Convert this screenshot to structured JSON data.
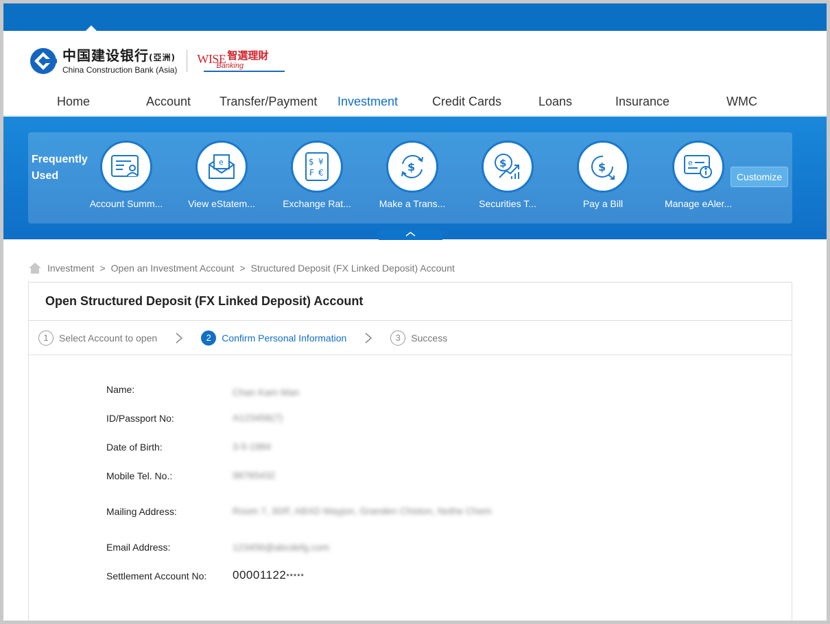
{
  "brand": {
    "cn_name": "中国建设银行",
    "cn_suffix": "(亞洲)",
    "en_name": "China Construction Bank (Asia)",
    "wise_word": "WISE",
    "wise_cn": "智選理財",
    "wise_banking": "Banking",
    "accent": "#0b6fc3"
  },
  "nav": {
    "items": [
      {
        "label": "Home"
      },
      {
        "label": "Account"
      },
      {
        "label": "Transfer/Payment"
      },
      {
        "label": "Investment",
        "active": true
      },
      {
        "label": "Credit Cards"
      },
      {
        "label": "Loans"
      },
      {
        "label": "Insurance"
      },
      {
        "label": "WMC"
      }
    ]
  },
  "frequently_used": {
    "title": "Frequently Used",
    "items": [
      {
        "label": "Account Summ...",
        "icon": "account-summary-icon"
      },
      {
        "label": "View eStatem...",
        "icon": "estatement-icon"
      },
      {
        "label": "Exchange Rat...",
        "icon": "exchange-rate-icon"
      },
      {
        "label": "Make a Trans...",
        "icon": "transfer-icon"
      },
      {
        "label": "Securities T...",
        "icon": "securities-icon"
      },
      {
        "label": "Pay a Bill",
        "icon": "pay-bill-icon"
      },
      {
        "label": "Manage eAler...",
        "icon": "ealert-icon"
      }
    ],
    "customize_label": "Customize"
  },
  "breadcrumb": {
    "items": [
      "Investment",
      "Open an Investment Account",
      "Structured Deposit (FX Linked Deposit) Account"
    ],
    "separator": ">"
  },
  "page": {
    "title": "Open Structured Deposit (FX Linked Deposit) Account"
  },
  "steps": [
    {
      "num": "1",
      "label": "Select Account to open"
    },
    {
      "num": "2",
      "label": "Confirm Personal Information",
      "active": true
    },
    {
      "num": "3",
      "label": "Success"
    }
  ],
  "personal_info": [
    {
      "label": "Name:",
      "value": "Chan Kam Man"
    },
    {
      "label": "ID/Passport No:",
      "value": "A123456(7)"
    },
    {
      "label": "Date of Birth:",
      "value": "3-5-1984"
    },
    {
      "label": "Mobile Tel. No.:",
      "value": "98765432"
    },
    {
      "label": "Mailing Address:",
      "value": "Room 7, 30/F, ABXD Mayjon, Granden Chiston, Nothe Chem"
    },
    {
      "label": "Email Address:",
      "value": "123456@abcdefg.com"
    },
    {
      "label": "Settlement Account No:",
      "value": "00001122",
      "mask": "*****"
    }
  ]
}
